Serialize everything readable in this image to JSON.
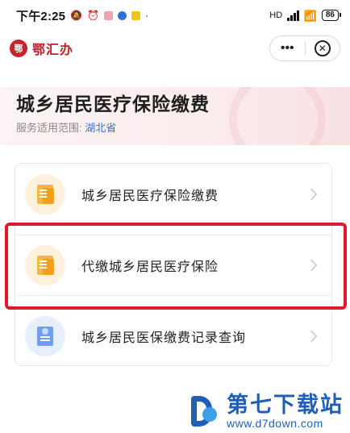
{
  "status_bar": {
    "time": "下午2:25",
    "battery": "86",
    "network": "HD"
  },
  "nav": {
    "brand_name": "鄂汇办",
    "brand_logo_text": "鄂",
    "more_icon": "more-dots-icon",
    "close_icon": "close-circle-icon"
  },
  "header": {
    "title": "城乡居民医疗保险缴费",
    "scope_label": "服务适用范围:",
    "scope_value": "湖北省"
  },
  "services": [
    {
      "label": "城乡居民医疗保险缴费",
      "icon": "orange-document-icon"
    },
    {
      "label": "代缴城乡居民医疗保险",
      "icon": "orange-document-icon"
    },
    {
      "label": "城乡居民医保缴费记录查询",
      "icon": "blue-document-icon"
    }
  ],
  "watermark": {
    "name": "第七下载站",
    "url": "www.d7down.com"
  },
  "colors": {
    "brand_red": "#c01f2a",
    "highlight_red": "#e0182a",
    "link_blue": "#3b6fc9",
    "icon_orange": "#f3a01e",
    "icon_blue": "#6e9ff1"
  }
}
